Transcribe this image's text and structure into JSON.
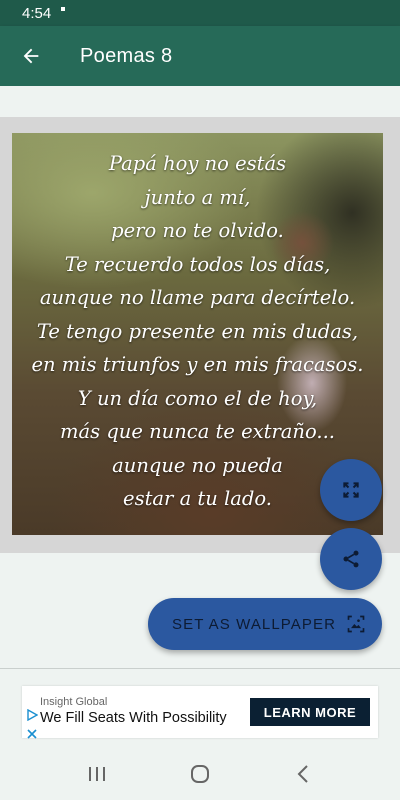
{
  "status_bar": {
    "time": "4:54"
  },
  "app_bar": {
    "title": "Poemas 8",
    "back_icon": "arrow-left-icon"
  },
  "poem": {
    "lines": [
      "Papá hoy no estás",
      "junto a mí,",
      "pero no te olvido.",
      "Te recuerdo todos los días,",
      "aunque no llame para decírtelo.",
      "Te tengo presente en mis dudas,",
      "en mis triunfos y en mis fracasos.",
      "Y un día como el de hoy,",
      "más que nunca te extraño...",
      "aunque no pueda",
      "estar a tu lado."
    ]
  },
  "actions": {
    "expand_icon": "fullscreen-icon",
    "share_icon": "share-icon",
    "wallpaper_label": "SET AS WALLPAPER",
    "wallpaper_icon": "wallpaper-icon"
  },
  "ad": {
    "brand": "Insight Global",
    "headline": "We Fill Seats With Possibility",
    "cta": "LEARN MORE"
  },
  "colors": {
    "status_bar": "#1f5a4a",
    "app_bar": "#266a58",
    "fab": "#2b58a0",
    "ad_cta": "#0b2033"
  }
}
